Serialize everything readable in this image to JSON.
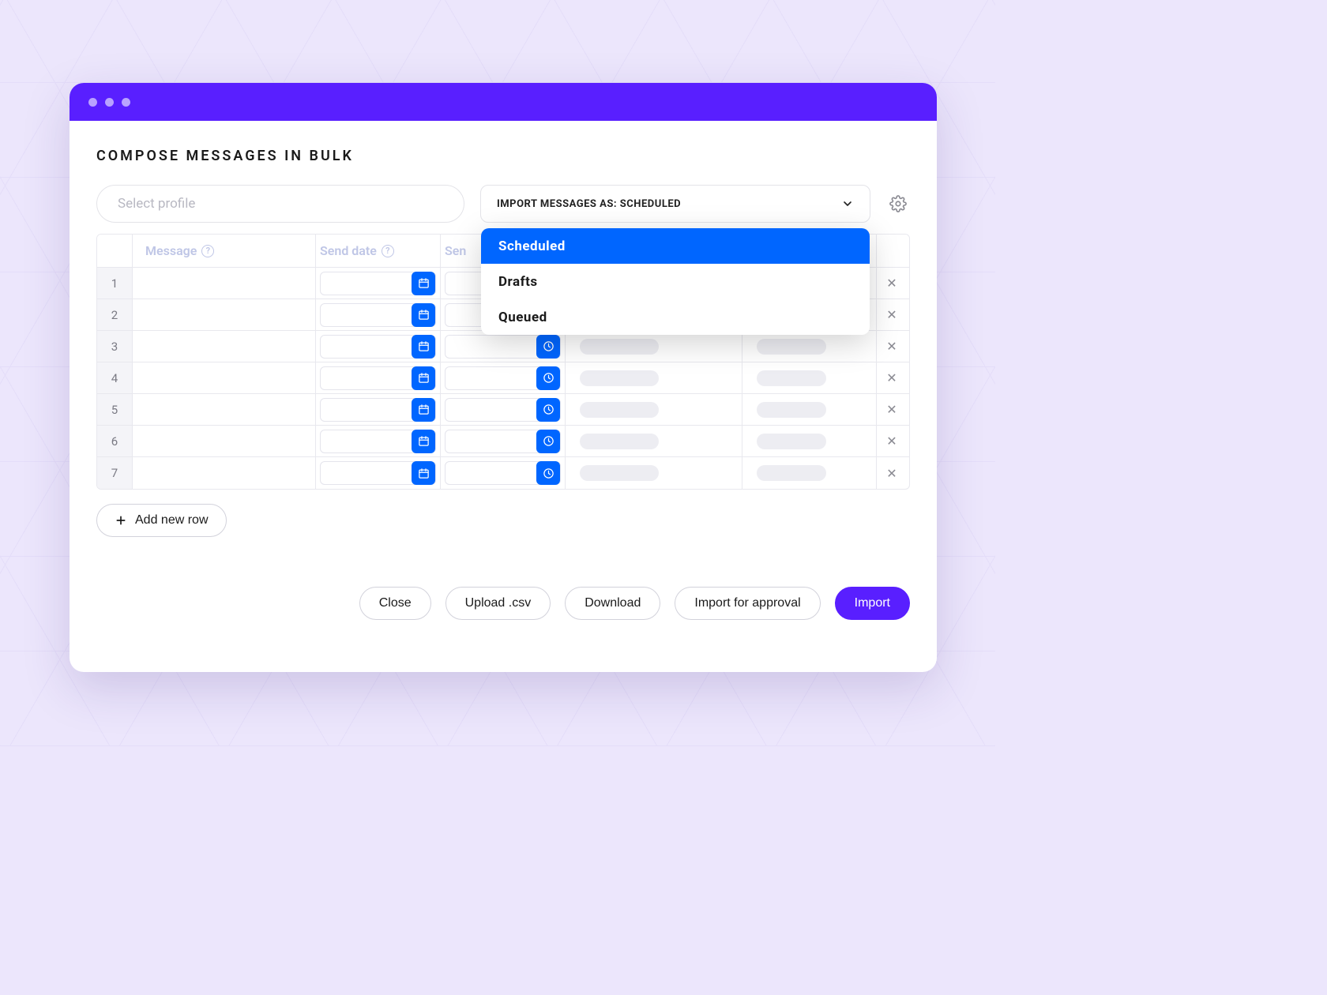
{
  "page": {
    "title": "Compose Messages in Bulk"
  },
  "controls": {
    "profile_placeholder": "Select profile",
    "import_label_prefix": "IMPORT MESSAGES AS: ",
    "import_selected": "SCHEDULED",
    "dropdown_options": [
      "Scheduled",
      "Drafts",
      "Queued"
    ]
  },
  "table": {
    "headers": {
      "message": "Message",
      "send_date": "Send date",
      "send_time": "Sen"
    },
    "rows": [
      {
        "num": "1"
      },
      {
        "num": "2"
      },
      {
        "num": "3"
      },
      {
        "num": "4"
      },
      {
        "num": "5"
      },
      {
        "num": "6"
      },
      {
        "num": "7"
      }
    ]
  },
  "actions": {
    "add_row": "Add new row",
    "close": "Close",
    "upload": "Upload .csv",
    "download": "Download",
    "approval": "Import for approval",
    "import": "Import"
  }
}
